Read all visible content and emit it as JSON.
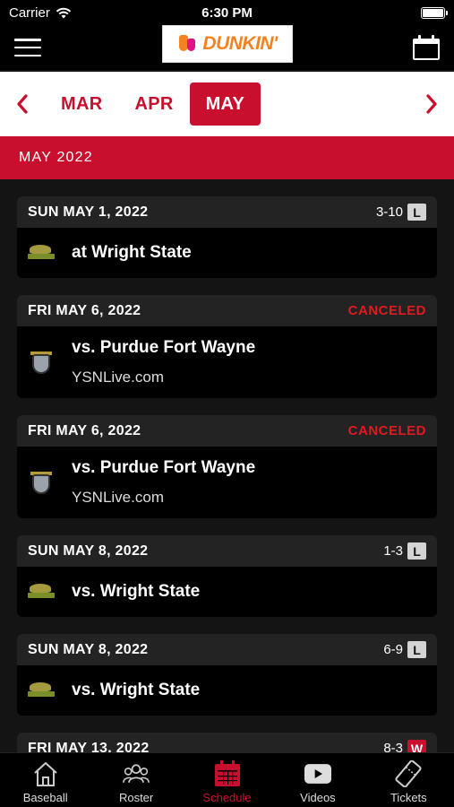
{
  "status_bar": {
    "carrier": "Carrier",
    "time": "6:30 PM"
  },
  "header": {
    "sponsor": "DUNKIN'",
    "menu_icon": "hamburger-menu-icon",
    "calendar_icon": "calendar-icon"
  },
  "month_picker": {
    "prev_icon": "chevron-left-icon",
    "next_icon": "chevron-right-icon",
    "months": [
      {
        "label": "MAR",
        "active": false
      },
      {
        "label": "APR",
        "active": false
      },
      {
        "label": "MAY",
        "active": true
      }
    ]
  },
  "month_header": "MAY 2022",
  "colors": {
    "accent": "#c8102e",
    "canceled": "#e2191f",
    "card_header": "#232323",
    "background": "#141414"
  },
  "games": [
    {
      "date": "SUN MAY 1, 2022",
      "score": "3-10",
      "result": "L",
      "canceled": "",
      "opponent": "at Wright State",
      "broadcast": "",
      "team": "wright-state"
    },
    {
      "date": "FRI MAY 6, 2022",
      "score": "",
      "result": "",
      "canceled": "CANCELED",
      "opponent": "vs. Purdue Fort Wayne",
      "broadcast": "YSNLive.com",
      "team": "purdue-fort-wayne"
    },
    {
      "date": "FRI MAY 6, 2022",
      "score": "",
      "result": "",
      "canceled": "CANCELED",
      "opponent": "vs. Purdue Fort Wayne",
      "broadcast": "YSNLive.com",
      "team": "purdue-fort-wayne"
    },
    {
      "date": "SUN MAY 8, 2022",
      "score": "1-3",
      "result": "L",
      "canceled": "",
      "opponent": "vs. Wright State",
      "broadcast": "",
      "team": "wright-state"
    },
    {
      "date": "SUN MAY 8, 2022",
      "score": "6-9",
      "result": "L",
      "canceled": "",
      "opponent": "vs. Wright State",
      "broadcast": "",
      "team": "wright-state"
    },
    {
      "date": "FRI MAY 13, 2022",
      "score": "8-3",
      "result": "W",
      "canceled": "",
      "opponent": "",
      "broadcast": "",
      "team": ""
    }
  ],
  "tabs": [
    {
      "label": "Baseball",
      "icon": "home-icon",
      "active": false
    },
    {
      "label": "Roster",
      "icon": "roster-icon",
      "active": false
    },
    {
      "label": "Schedule",
      "icon": "calendar-icon",
      "active": true
    },
    {
      "label": "Videos",
      "icon": "video-play-icon",
      "active": false
    },
    {
      "label": "Tickets",
      "icon": "ticket-icon",
      "active": false
    }
  ]
}
